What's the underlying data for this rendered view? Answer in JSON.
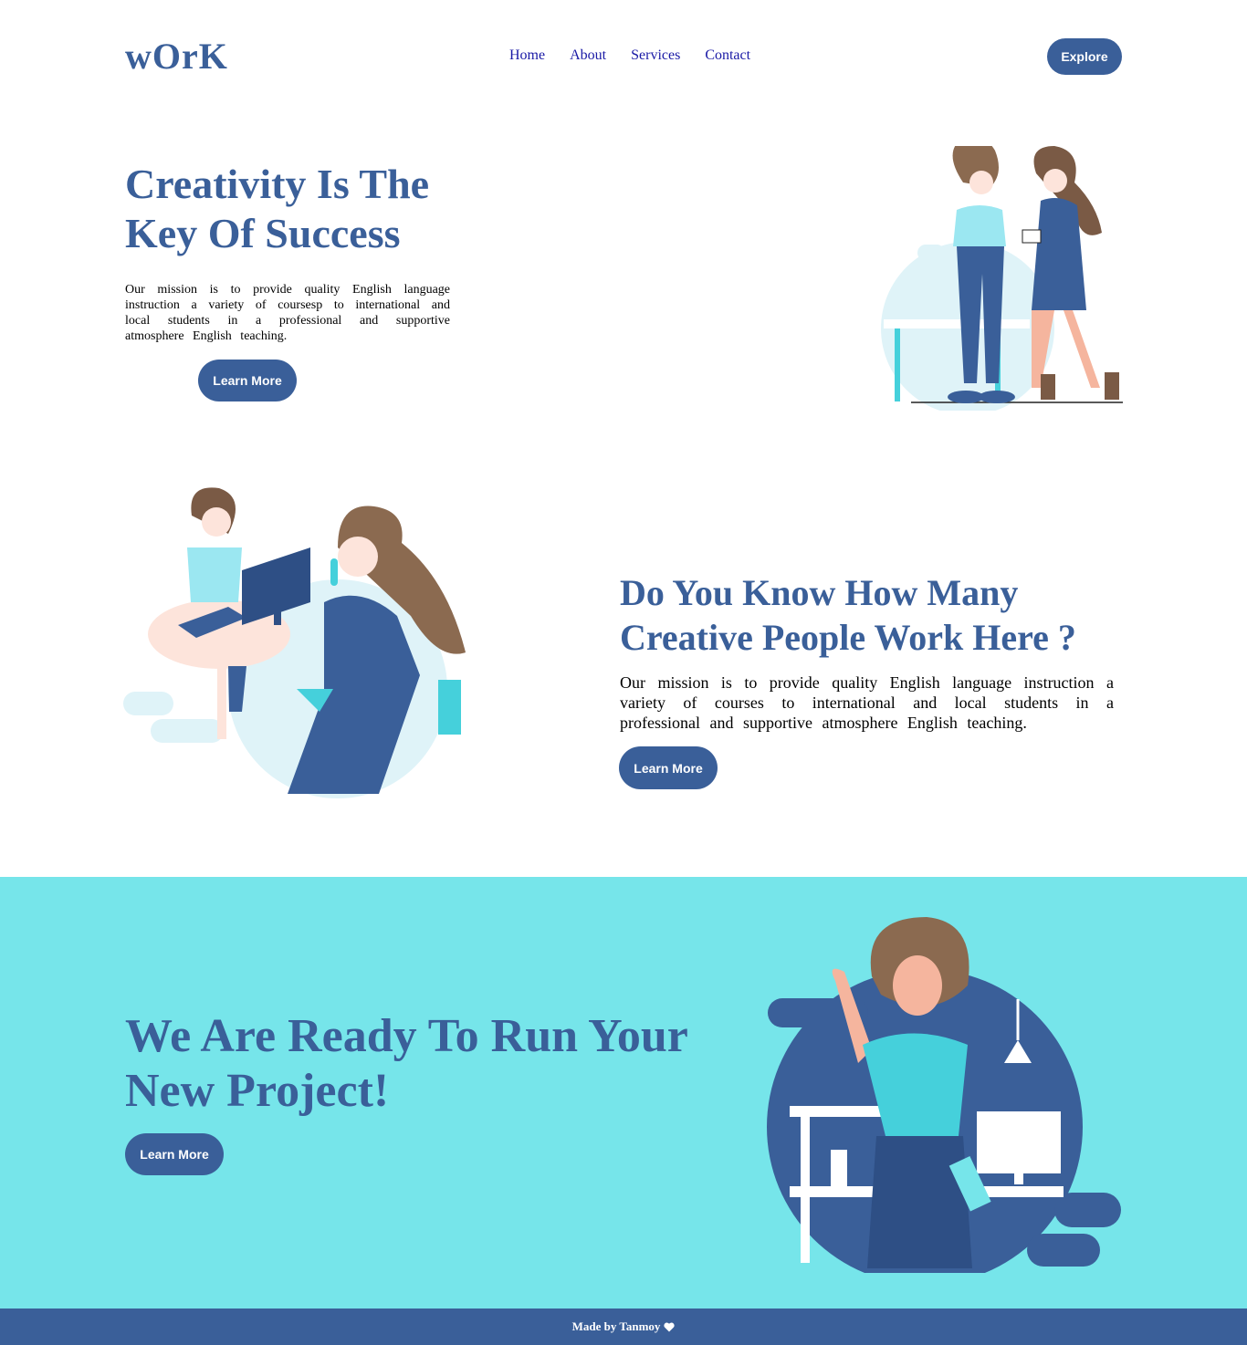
{
  "header": {
    "logo": "wOrK",
    "nav": [
      "Home",
      "About",
      "Services",
      "Contact"
    ],
    "explore_label": "Explore"
  },
  "hero": {
    "title_line1": "Creativity Is The",
    "title_line2": "Key Of Success",
    "paragraph": "Our mission is to provide quality English language instruction a variety of coursesp to international and local students in a professional and supportive atmosphere English teaching.",
    "cta_label": "Learn More"
  },
  "section2": {
    "title_line1": "Do You Know How Many",
    "title_line2": "Creative People Work Here ?",
    "paragraph": "Our mission is to provide quality English language instruction a variety of courses to international and local students in a professional and supportive atmosphere English teaching.",
    "cta_label": "Learn More"
  },
  "section3": {
    "title_line1": "We Are Ready To Run Your",
    "title_line2": "New Project!",
    "cta_label": "Learn More"
  },
  "footer": {
    "text": "Made by Tanmoy",
    "icon": "heart-icon"
  },
  "colors": {
    "primary": "#3a5f99",
    "teal": "#76e5ea",
    "nav_link": "#1a1aa6"
  }
}
